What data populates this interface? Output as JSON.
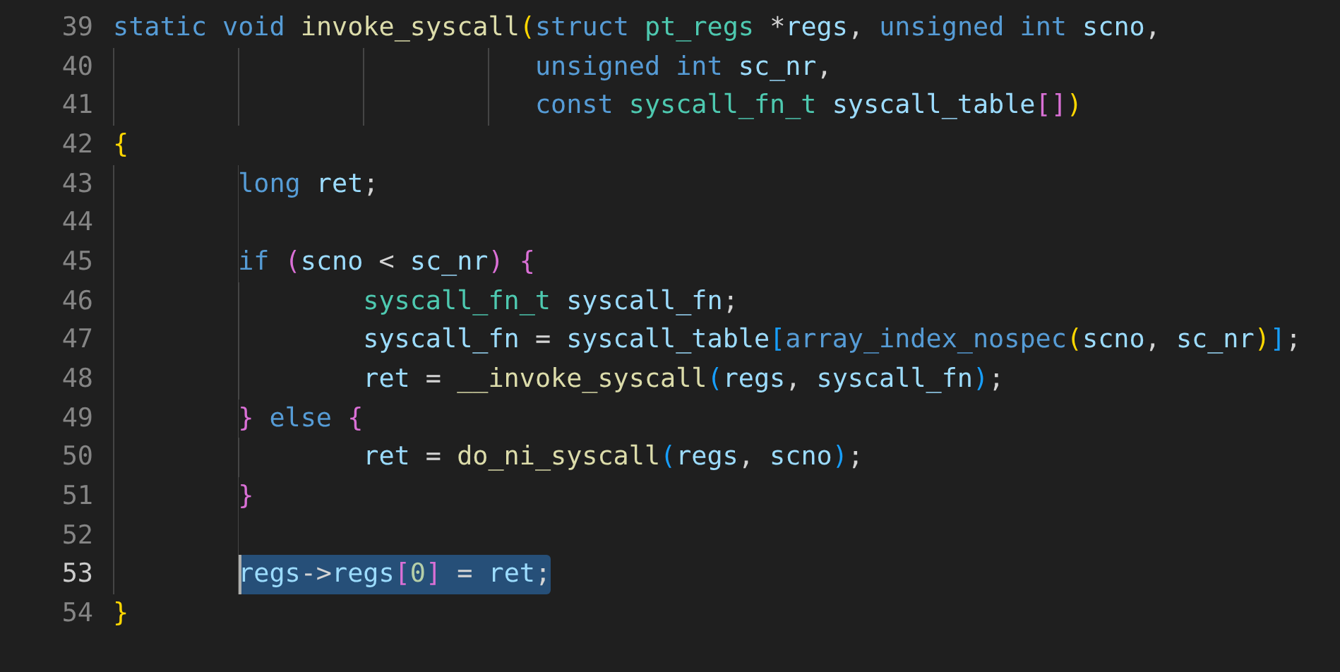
{
  "lines": [
    {
      "number": "39",
      "tokens": [
        {
          "text": "static",
          "kind": "keyword"
        },
        {
          "text": " void",
          "kind": "keyword"
        },
        {
          "text": " invoke_syscall",
          "kind": "function"
        },
        {
          "text": "(",
          "kind": "brace1"
        },
        {
          "text": "struct",
          "kind": "keyword"
        },
        {
          "text": " pt_regs",
          "kind": "type"
        },
        {
          "text": " *",
          "kind": "plain"
        },
        {
          "text": "regs",
          "kind": "variable"
        },
        {
          "text": ",",
          "kind": "plain"
        },
        {
          "text": " unsigned",
          "kind": "keyword"
        },
        {
          "text": " int",
          "kind": "keyword"
        },
        {
          "text": " scno",
          "kind": "variable"
        },
        {
          "text": ",",
          "kind": "plain"
        }
      ]
    },
    {
      "number": "40",
      "tokens": [
        {
          "text": "\t\t\t   unsigned",
          "kind": "keyword"
        },
        {
          "text": " int",
          "kind": "keyword"
        },
        {
          "text": " sc_nr",
          "kind": "variable"
        },
        {
          "text": ",",
          "kind": "plain"
        }
      ]
    },
    {
      "number": "41",
      "tokens": [
        {
          "text": "\t\t\t   const",
          "kind": "keyword"
        },
        {
          "text": " syscall_fn_t",
          "kind": "type"
        },
        {
          "text": " syscall_table",
          "kind": "variable"
        },
        {
          "text": "[]",
          "kind": "brace2"
        },
        {
          "text": ")",
          "kind": "brace1"
        }
      ]
    },
    {
      "number": "42",
      "tokens": [
        {
          "text": "{",
          "kind": "brace1"
        }
      ]
    },
    {
      "number": "43",
      "tokens": [
        {
          "text": "\tlong",
          "kind": "keyword"
        },
        {
          "text": " ret",
          "kind": "variable"
        },
        {
          "text": ";",
          "kind": "plain"
        }
      ]
    },
    {
      "number": "44"
    },
    {
      "number": "45",
      "tokens": [
        {
          "text": "\tif",
          "kind": "keyword"
        },
        {
          "text": " (",
          "kind": "brace2"
        },
        {
          "text": "scno",
          "kind": "variable"
        },
        {
          "text": " < ",
          "kind": "plain"
        },
        {
          "text": "sc_nr",
          "kind": "variable"
        },
        {
          "text": ")",
          "kind": "brace2"
        },
        {
          "text": " {",
          "kind": "brace2"
        }
      ]
    },
    {
      "number": "46",
      "tokens": [
        {
          "text": "\t\tsyscall_fn_t",
          "kind": "type"
        },
        {
          "text": " syscall_fn",
          "kind": "variable"
        },
        {
          "text": ";",
          "kind": "plain"
        }
      ]
    },
    {
      "number": "47",
      "tokens": [
        {
          "text": "\t\tsyscall_fn",
          "kind": "variable"
        },
        {
          "text": " = ",
          "kind": "plain"
        },
        {
          "text": "syscall_table",
          "kind": "variable"
        },
        {
          "text": "[",
          "kind": "brace3"
        },
        {
          "text": "array_index_nospec",
          "kind": "macro"
        },
        {
          "text": "(",
          "kind": "brace1"
        },
        {
          "text": "scno",
          "kind": "variable"
        },
        {
          "text": ", ",
          "kind": "plain"
        },
        {
          "text": "sc_nr",
          "kind": "variable"
        },
        {
          "text": ")",
          "kind": "brace1"
        },
        {
          "text": "]",
          "kind": "brace3"
        },
        {
          "text": ";",
          "kind": "plain"
        }
      ]
    },
    {
      "number": "48",
      "tokens": [
        {
          "text": "\t\tret",
          "kind": "variable"
        },
        {
          "text": " = ",
          "kind": "plain"
        },
        {
          "text": "__invoke_syscall",
          "kind": "function"
        },
        {
          "text": "(",
          "kind": "brace3"
        },
        {
          "text": "regs",
          "kind": "variable"
        },
        {
          "text": ", ",
          "kind": "plain"
        },
        {
          "text": "syscall_fn",
          "kind": "variable"
        },
        {
          "text": ")",
          "kind": "brace3"
        },
        {
          "text": ";",
          "kind": "plain"
        }
      ]
    },
    {
      "number": "49",
      "tokens": [
        {
          "text": "\t}",
          "kind": "brace2"
        },
        {
          "text": " else",
          "kind": "keyword"
        },
        {
          "text": " {",
          "kind": "brace2"
        }
      ]
    },
    {
      "number": "50",
      "tokens": [
        {
          "text": "\t\tret",
          "kind": "variable"
        },
        {
          "text": " = ",
          "kind": "plain"
        },
        {
          "text": "do_ni_syscall",
          "kind": "function"
        },
        {
          "text": "(",
          "kind": "brace3"
        },
        {
          "text": "regs",
          "kind": "variable"
        },
        {
          "text": ", ",
          "kind": "plain"
        },
        {
          "text": "scno",
          "kind": "variable"
        },
        {
          "text": ")",
          "kind": "brace3"
        },
        {
          "text": ";",
          "kind": "plain"
        }
      ]
    },
    {
      "number": "51",
      "tokens": [
        {
          "text": "\t}",
          "kind": "brace2"
        }
      ]
    },
    {
      "number": "52"
    },
    {
      "number": "53",
      "active": true,
      "selected": true,
      "tokens": [
        {
          "text": "\tregs",
          "kind": "variable"
        },
        {
          "text": "->",
          "kind": "plain"
        },
        {
          "text": "regs",
          "kind": "variable"
        },
        {
          "text": "[",
          "kind": "brace2"
        },
        {
          "text": "0",
          "kind": "number"
        },
        {
          "text": "]",
          "kind": "brace2"
        },
        {
          "text": " = ",
          "kind": "plain"
        },
        {
          "text": "ret",
          "kind": "variable"
        },
        {
          "text": ";",
          "kind": "plain"
        }
      ]
    },
    {
      "number": "54",
      "tokens": [
        {
          "text": "}",
          "kind": "brace1"
        }
      ]
    }
  ]
}
